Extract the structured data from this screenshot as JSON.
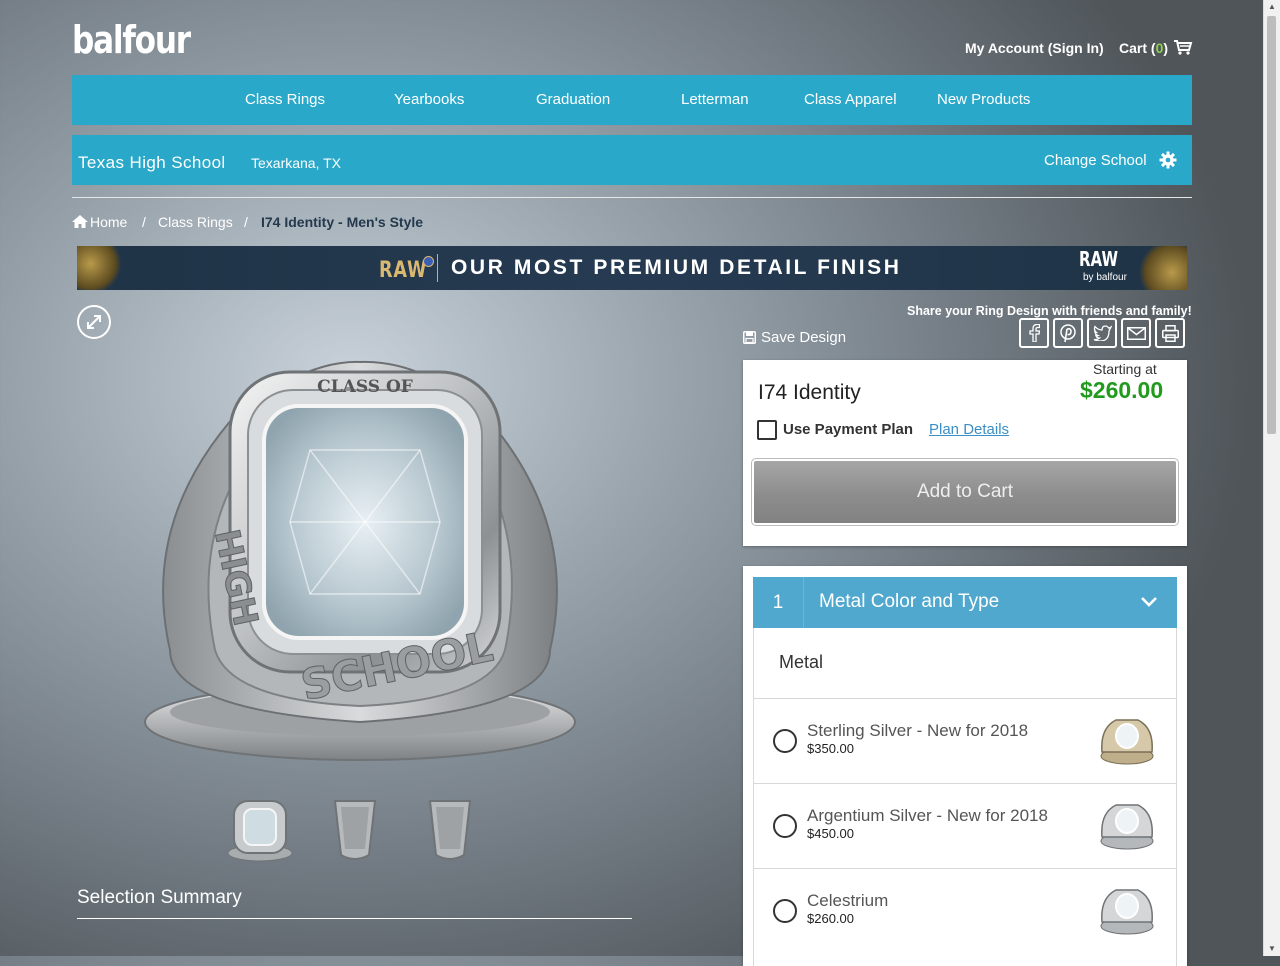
{
  "header": {
    "logo": "balfour",
    "account_label": "My Account (Sign In)",
    "cart_label": "Cart (",
    "cart_count": "0",
    "cart_close": ")"
  },
  "nav": {
    "items": [
      "Class Rings",
      "Yearbooks",
      "Graduation",
      "Letterman",
      "Class Apparel",
      "New Products"
    ]
  },
  "school": {
    "name": "Texas High School",
    "location": "Texarkana, TX",
    "change_label": "Change School"
  },
  "breadcrumb": {
    "home": "Home",
    "sep": "/",
    "category": "Class Rings",
    "current": "I74 Identity - Men's Style"
  },
  "banner": {
    "raw": "RAW",
    "tagline": "OUR MOST PREMIUM DETAIL FINISH",
    "brand_raw": "RAW",
    "brand_sub": "by balfour"
  },
  "ring_engraving": {
    "top": "CLASS OF",
    "side": "SCHOOL",
    "side_left": "HIGH"
  },
  "summary": {
    "title": "Selection Summary"
  },
  "share": {
    "text": "Share your Ring Design with friends and family!",
    "save_label": "Save Design",
    "buttons": [
      "facebook-icon",
      "pinterest-icon",
      "twitter-icon",
      "email-icon",
      "print-icon"
    ]
  },
  "product": {
    "name": "I74 Identity",
    "starting_label": "Starting at",
    "price": "$260.00",
    "payment_plan_label": "Use Payment Plan",
    "plan_details_label": "Plan Details",
    "add_to_cart_label": "Add to Cart"
  },
  "options": {
    "step_number": "1",
    "step_title": "Metal Color and Type",
    "section_label": "Metal",
    "metals": [
      {
        "name": "Sterling Silver - New for 2018",
        "price": "$350.00"
      },
      {
        "name": "Argentium Silver - New for 2018",
        "price": "$450.00"
      },
      {
        "name": "Celestrium",
        "price": "$260.00"
      }
    ]
  },
  "colors": {
    "nav_bg": "#2aa8c9",
    "option_header_bg": "#50a8ce",
    "price_green": "#229a1e",
    "breadcrumb_current": "#24394d"
  }
}
